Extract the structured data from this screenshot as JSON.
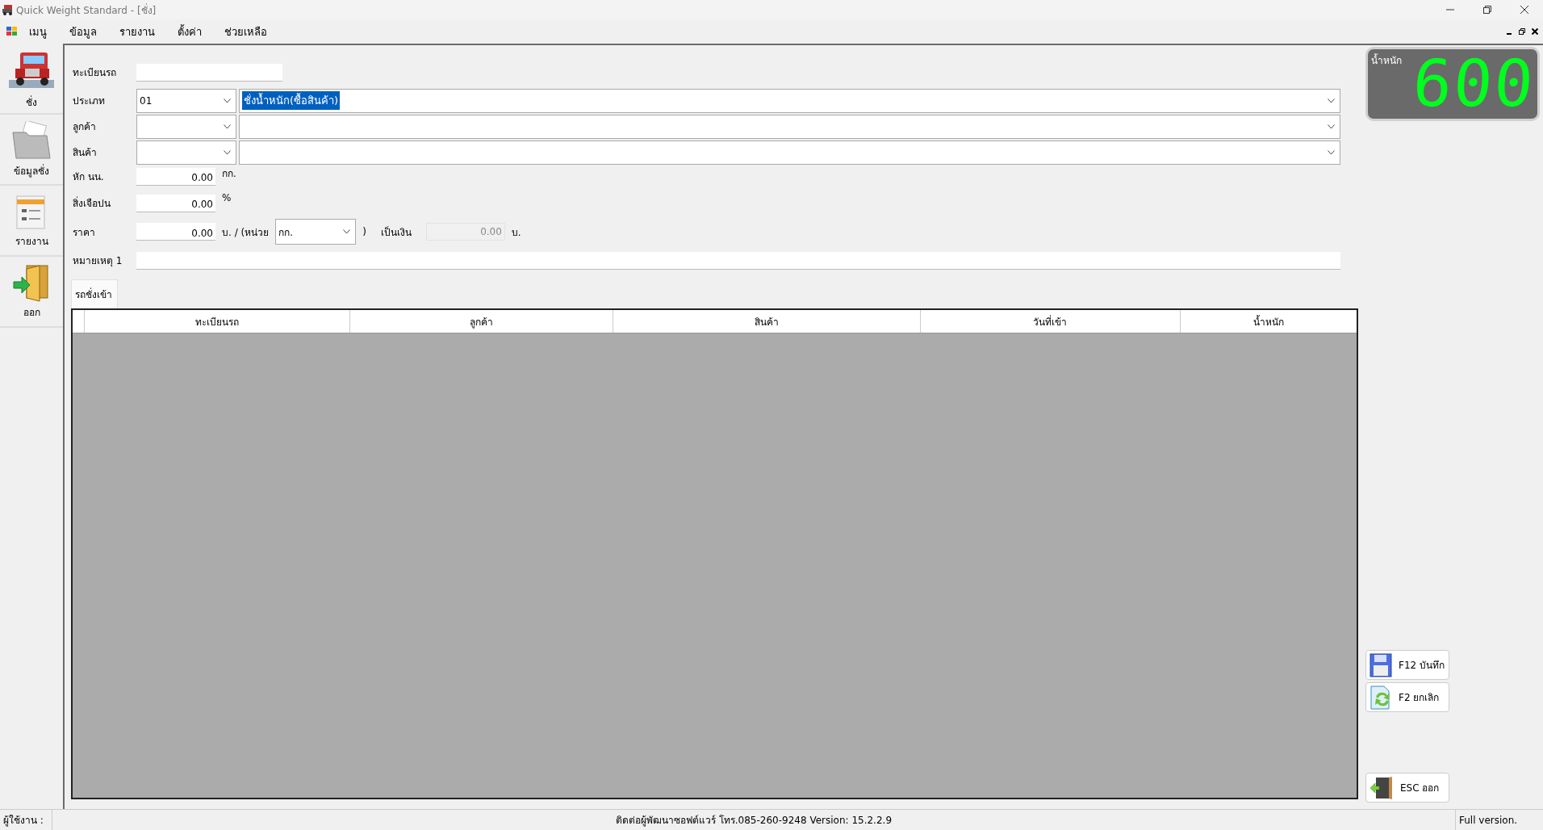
{
  "window": {
    "title": "Quick Weight Standard - [ชั่ง]"
  },
  "menu": [
    {
      "label": "เมนู"
    },
    {
      "label": "ข้อมูล"
    },
    {
      "label": "รายงาน"
    },
    {
      "label": "ตั้งค่า"
    },
    {
      "label": "ช่วยเหลือ"
    }
  ],
  "sidebar": [
    {
      "label": "ชั่ง",
      "kind": "truck"
    },
    {
      "label": "ข้อมูลชั่ง",
      "kind": "folder"
    },
    {
      "label": "รายงาน",
      "kind": "report"
    },
    {
      "label": "ออก",
      "kind": "exit"
    }
  ],
  "form": {
    "plate": {
      "label": "ทะเบียนรถ"
    },
    "type": {
      "label": "ประเภท",
      "code": "01",
      "name": "ชั่งน้ำหนัก(ซื้อสินค้า)",
      "name_highlighted": true
    },
    "customer": {
      "label": "ลูกค้า"
    },
    "product": {
      "label": "สินค้า"
    },
    "deduction": {
      "label": "หัก นน.",
      "value": "0.00",
      "unit": "กก."
    },
    "impurity": {
      "label": "สิ่งเจือปน",
      "value": "0.00",
      "unit": "%"
    },
    "price": {
      "label": "ราคา",
      "value": "0.00",
      "per_unit_label": "บ. / (หน่วย",
      "unit": "กก.",
      "close": ")",
      "amount_label": "เป็นเงิน",
      "amount": "0.00",
      "amount_disabled": true,
      "amount_unit": "บ."
    },
    "note": {
      "label": "หมายเหตุ 1"
    }
  },
  "weight_display": {
    "label": "น้ำหนัก",
    "value": "600"
  },
  "tabs": [
    {
      "label": "รถชั่งเข้า",
      "selected": true
    }
  ],
  "table": {
    "columns": [
      "ทะเบียนรถ",
      "ลูกค้า",
      "สินค้า",
      "วันที่เข้า",
      "น้ำหนัก"
    ]
  },
  "buttons": [
    {
      "label": "F12 บันทึก",
      "kind": "save"
    },
    {
      "label": "F2 ยกเลิก",
      "kind": "cancel"
    },
    {
      "label": "ESC ออก",
      "kind": "exit"
    }
  ],
  "status_bar": {
    "user_label": "ผู้ใช้งาน :",
    "info": "ติดต่อผู้พัฒนาซอฟต์แวร์ โทร.085-260-9248 Version: 15.2.2.9",
    "license": "Full version."
  }
}
